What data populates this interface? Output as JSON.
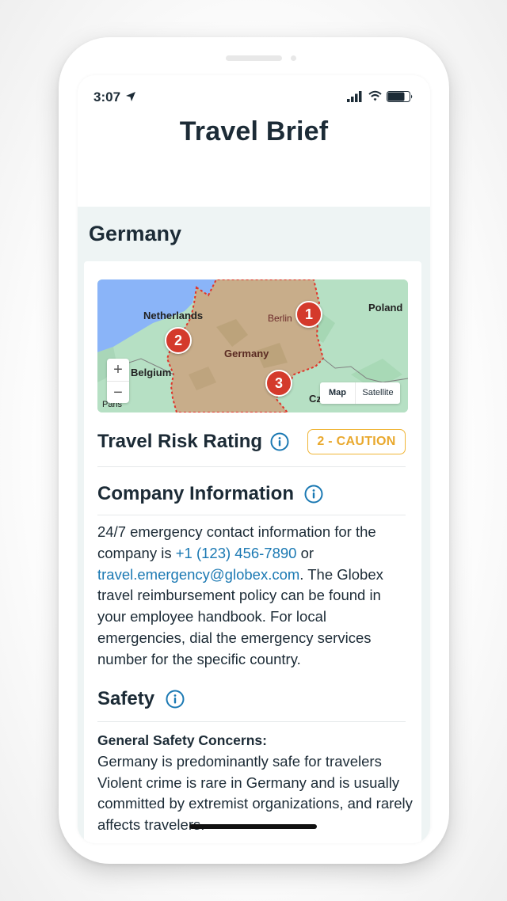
{
  "status_bar": {
    "time": "3:07",
    "icons": [
      "location-arrow-icon",
      "cellular-signal-icon",
      "wifi-icon",
      "battery-icon"
    ]
  },
  "header": {
    "title": "Travel Brief"
  },
  "country": {
    "name": "Germany"
  },
  "map": {
    "labels": {
      "netherlands": "Netherlands",
      "berlin": "Berlin",
      "poland": "Poland",
      "germany": "Germany",
      "belgium": "Belgium",
      "paris": "Paris",
      "czech": "Cz"
    },
    "markers": [
      "1",
      "2",
      "3"
    ],
    "zoom_in": "+",
    "zoom_out": "−",
    "map_type": {
      "map": "Map",
      "satellite": "Satellite",
      "selected": "Map"
    },
    "colors": {
      "water": "#8ab4f8",
      "land": "#b6e0c4",
      "highlight": "#c8ad8a",
      "border": "#e0342a",
      "marker": "#d43a2c"
    }
  },
  "risk": {
    "heading": "Travel Risk Rating",
    "badge": "2 - CAUTION",
    "badge_color": "#f0b537"
  },
  "company": {
    "heading": "Company Information",
    "text_1": "24/7 emergency contact information for the company is ",
    "phone": "+1 (123) 456-7890",
    "text_2": " or ",
    "email": "travel.emergency@globex.com",
    "text_3": ". The Globex travel reimbursement policy can be found in your employee handbook. For local emergencies, dial the emergency services number for the specific country."
  },
  "safety": {
    "heading": "Safety",
    "subheading": "General Safety Concerns:",
    "text": "Germany is predominantly safe for travelers Violent crime is rare in Germany and is usually committed by extremist organizations, and rarely affects travelers."
  },
  "link_color": "#1b79b3"
}
